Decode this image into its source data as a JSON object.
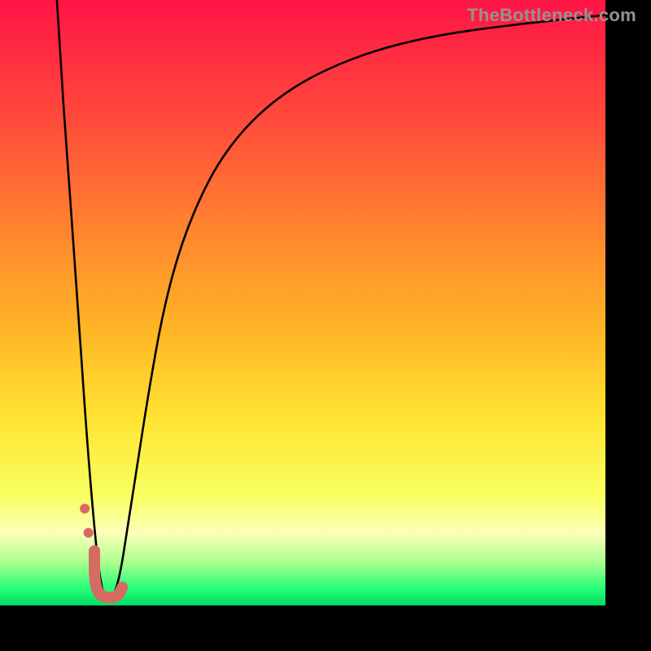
{
  "watermark": "TheBottleneck.com",
  "chart_data": {
    "type": "line",
    "title": "",
    "xlabel": "",
    "ylabel": "",
    "xlim": [
      0,
      100
    ],
    "ylim": [
      0,
      100
    ],
    "grid": false,
    "legend": false,
    "gradient_stops": [
      {
        "pos": 0.0,
        "color": "#ff1446"
      },
      {
        "pos": 0.2,
        "color": "#ff4b3b"
      },
      {
        "pos": 0.4,
        "color": "#ff8a2d"
      },
      {
        "pos": 0.55,
        "color": "#ffb726"
      },
      {
        "pos": 0.7,
        "color": "#ffe633"
      },
      {
        "pos": 0.82,
        "color": "#f7ff62"
      },
      {
        "pos": 0.88,
        "color": "#fdffb9"
      },
      {
        "pos": 0.93,
        "color": "#a8ff8e"
      },
      {
        "pos": 0.97,
        "color": "#2bff7a"
      },
      {
        "pos": 1.0,
        "color": "#00de62"
      }
    ],
    "series": [
      {
        "name": "bottleneck-curve",
        "style": {
          "stroke": "#000000",
          "stroke_width": 2.6
        },
        "x": [
          9.4,
          10.0,
          11.0,
          12.5,
          14.5,
          16.5,
          17.9,
          19.0,
          20.0,
          21.0,
          22.5,
          24.5,
          27.0,
          30.0,
          34.0,
          38.0,
          43.0,
          49.0,
          56.0,
          64.0,
          73.0,
          83.0,
          93.0,
          100.0
        ],
        "values": [
          100,
          90.0,
          75.0,
          55.0,
          25.0,
          3.0,
          1.0,
          2.0,
          6.0,
          12.5,
          22.0,
          35.0,
          49.0,
          60.0,
          69.5,
          76.0,
          81.5,
          86.0,
          89.5,
          92.3,
          94.3,
          95.7,
          96.8,
          97.5
        ]
      }
    ],
    "annotations": {
      "hook_marker": {
        "color": "#d66b63",
        "stroke_width": 14,
        "path_xy": [
          [
            15.6,
            9.0
          ],
          [
            15.6,
            3.5
          ],
          [
            16.7,
            1.3
          ],
          [
            19.4,
            1.3
          ],
          [
            20.2,
            3.0
          ]
        ],
        "dots": [
          {
            "x": 14.0,
            "y": 16.0,
            "r": 6
          },
          {
            "x": 14.6,
            "y": 12.0,
            "r": 6
          }
        ]
      }
    }
  }
}
